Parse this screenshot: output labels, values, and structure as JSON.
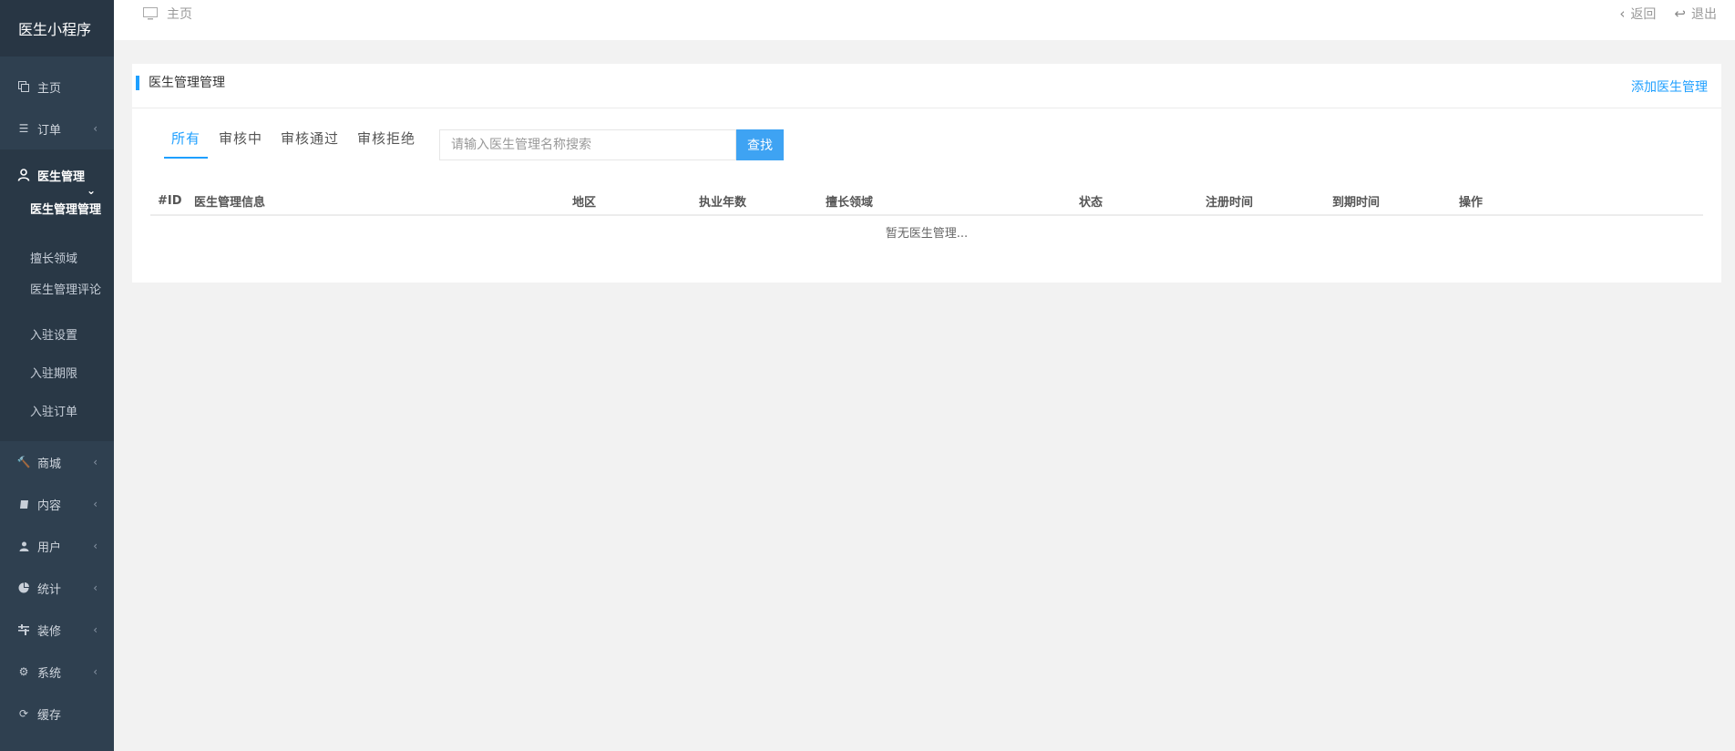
{
  "app": {
    "title": "医生小程序"
  },
  "sidebar": {
    "items": [
      {
        "label": "主页",
        "icon": "copy-icon"
      },
      {
        "label": "订单",
        "icon": "list-icon"
      },
      {
        "label": "医生管理",
        "icon": "user-icon"
      },
      {
        "label": "商城",
        "icon": "gavel-icon"
      },
      {
        "label": "内容",
        "icon": "book-icon"
      },
      {
        "label": "用户",
        "icon": "person-icon"
      },
      {
        "label": "统计",
        "icon": "pie-chart-icon"
      },
      {
        "label": "装修",
        "icon": "settings-sliders-icon"
      },
      {
        "label": "系统",
        "icon": "gear-icon"
      },
      {
        "label": "缓存",
        "icon": "refresh-icon"
      }
    ],
    "submenu": [
      {
        "label": "医生管理管理",
        "active": true
      },
      {
        "label": "擅长领域"
      },
      {
        "label": "医生管理评论"
      },
      {
        "label": "入驻设置"
      },
      {
        "label": "入驻期限"
      },
      {
        "label": "入驻订单"
      }
    ]
  },
  "topbar": {
    "breadcrumb": "主页",
    "back_label": "返回",
    "logout_label": "退出"
  },
  "panel": {
    "title": "医生管理管理",
    "add_link": "添加医生管理",
    "tabs": [
      {
        "label": "所有",
        "active": true
      },
      {
        "label": "审核中"
      },
      {
        "label": "审核通过"
      },
      {
        "label": "审核拒绝"
      }
    ],
    "search": {
      "placeholder": "请输入医生管理名称搜索",
      "button": "查找"
    },
    "table": {
      "columns": [
        "#ID",
        "医生管理信息",
        "地区",
        "执业年数",
        "擅长领域",
        "状态",
        "注册时间",
        "到期时间",
        "操作"
      ],
      "empty_text": "暂无医生管理..."
    }
  },
  "colors": {
    "sidebar_bg": "#2f4050",
    "accent": "#1e9fff",
    "button": "#3ea3f3",
    "page_bg": "#f2f2f2"
  }
}
